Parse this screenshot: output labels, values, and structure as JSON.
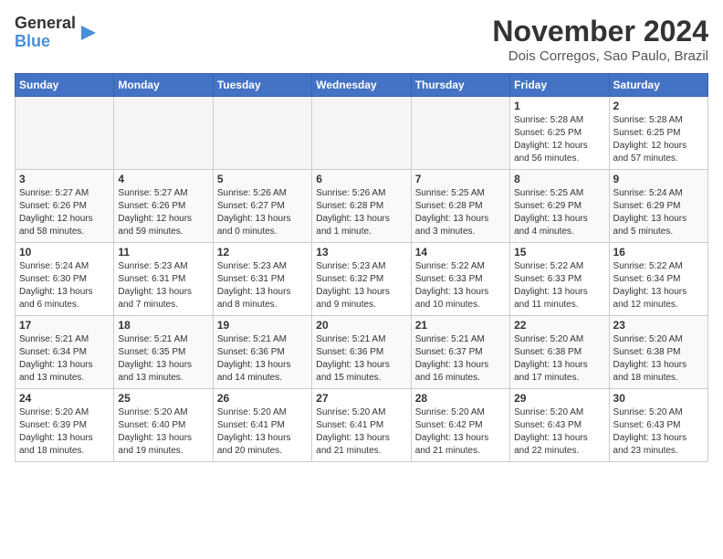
{
  "logo": {
    "line1": "General",
    "line2": "Blue"
  },
  "title": "November 2024",
  "location": "Dois Corregos, Sao Paulo, Brazil",
  "days_of_week": [
    "Sunday",
    "Monday",
    "Tuesday",
    "Wednesday",
    "Thursday",
    "Friday",
    "Saturday"
  ],
  "weeks": [
    [
      {
        "day": "",
        "info": ""
      },
      {
        "day": "",
        "info": ""
      },
      {
        "day": "",
        "info": ""
      },
      {
        "day": "",
        "info": ""
      },
      {
        "day": "",
        "info": ""
      },
      {
        "day": "1",
        "info": "Sunrise: 5:28 AM\nSunset: 6:25 PM\nDaylight: 12 hours and 56 minutes."
      },
      {
        "day": "2",
        "info": "Sunrise: 5:28 AM\nSunset: 6:25 PM\nDaylight: 12 hours and 57 minutes."
      }
    ],
    [
      {
        "day": "3",
        "info": "Sunrise: 5:27 AM\nSunset: 6:26 PM\nDaylight: 12 hours and 58 minutes."
      },
      {
        "day": "4",
        "info": "Sunrise: 5:27 AM\nSunset: 6:26 PM\nDaylight: 12 hours and 59 minutes."
      },
      {
        "day": "5",
        "info": "Sunrise: 5:26 AM\nSunset: 6:27 PM\nDaylight: 13 hours and 0 minutes."
      },
      {
        "day": "6",
        "info": "Sunrise: 5:26 AM\nSunset: 6:28 PM\nDaylight: 13 hours and 1 minute."
      },
      {
        "day": "7",
        "info": "Sunrise: 5:25 AM\nSunset: 6:28 PM\nDaylight: 13 hours and 3 minutes."
      },
      {
        "day": "8",
        "info": "Sunrise: 5:25 AM\nSunset: 6:29 PM\nDaylight: 13 hours and 4 minutes."
      },
      {
        "day": "9",
        "info": "Sunrise: 5:24 AM\nSunset: 6:29 PM\nDaylight: 13 hours and 5 minutes."
      }
    ],
    [
      {
        "day": "10",
        "info": "Sunrise: 5:24 AM\nSunset: 6:30 PM\nDaylight: 13 hours and 6 minutes."
      },
      {
        "day": "11",
        "info": "Sunrise: 5:23 AM\nSunset: 6:31 PM\nDaylight: 13 hours and 7 minutes."
      },
      {
        "day": "12",
        "info": "Sunrise: 5:23 AM\nSunset: 6:31 PM\nDaylight: 13 hours and 8 minutes."
      },
      {
        "day": "13",
        "info": "Sunrise: 5:23 AM\nSunset: 6:32 PM\nDaylight: 13 hours and 9 minutes."
      },
      {
        "day": "14",
        "info": "Sunrise: 5:22 AM\nSunset: 6:33 PM\nDaylight: 13 hours and 10 minutes."
      },
      {
        "day": "15",
        "info": "Sunrise: 5:22 AM\nSunset: 6:33 PM\nDaylight: 13 hours and 11 minutes."
      },
      {
        "day": "16",
        "info": "Sunrise: 5:22 AM\nSunset: 6:34 PM\nDaylight: 13 hours and 12 minutes."
      }
    ],
    [
      {
        "day": "17",
        "info": "Sunrise: 5:21 AM\nSunset: 6:34 PM\nDaylight: 13 hours and 13 minutes."
      },
      {
        "day": "18",
        "info": "Sunrise: 5:21 AM\nSunset: 6:35 PM\nDaylight: 13 hours and 13 minutes."
      },
      {
        "day": "19",
        "info": "Sunrise: 5:21 AM\nSunset: 6:36 PM\nDaylight: 13 hours and 14 minutes."
      },
      {
        "day": "20",
        "info": "Sunrise: 5:21 AM\nSunset: 6:36 PM\nDaylight: 13 hours and 15 minutes."
      },
      {
        "day": "21",
        "info": "Sunrise: 5:21 AM\nSunset: 6:37 PM\nDaylight: 13 hours and 16 minutes."
      },
      {
        "day": "22",
        "info": "Sunrise: 5:20 AM\nSunset: 6:38 PM\nDaylight: 13 hours and 17 minutes."
      },
      {
        "day": "23",
        "info": "Sunrise: 5:20 AM\nSunset: 6:38 PM\nDaylight: 13 hours and 18 minutes."
      }
    ],
    [
      {
        "day": "24",
        "info": "Sunrise: 5:20 AM\nSunset: 6:39 PM\nDaylight: 13 hours and 18 minutes."
      },
      {
        "day": "25",
        "info": "Sunrise: 5:20 AM\nSunset: 6:40 PM\nDaylight: 13 hours and 19 minutes."
      },
      {
        "day": "26",
        "info": "Sunrise: 5:20 AM\nSunset: 6:41 PM\nDaylight: 13 hours and 20 minutes."
      },
      {
        "day": "27",
        "info": "Sunrise: 5:20 AM\nSunset: 6:41 PM\nDaylight: 13 hours and 21 minutes."
      },
      {
        "day": "28",
        "info": "Sunrise: 5:20 AM\nSunset: 6:42 PM\nDaylight: 13 hours and 21 minutes."
      },
      {
        "day": "29",
        "info": "Sunrise: 5:20 AM\nSunset: 6:43 PM\nDaylight: 13 hours and 22 minutes."
      },
      {
        "day": "30",
        "info": "Sunrise: 5:20 AM\nSunset: 6:43 PM\nDaylight: 13 hours and 23 minutes."
      }
    ]
  ]
}
